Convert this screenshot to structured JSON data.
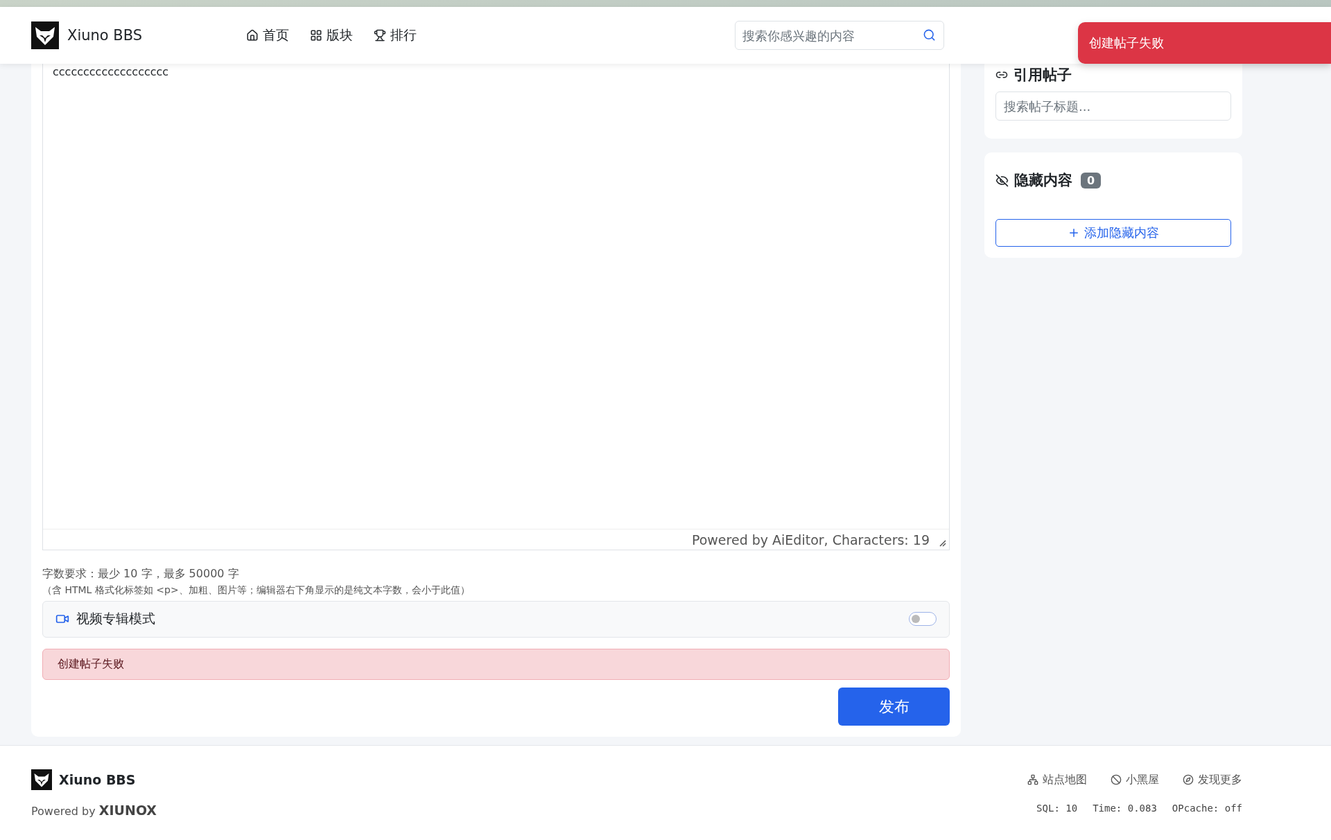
{
  "header": {
    "logo_text": "Xiuno BBS",
    "nav": [
      {
        "label": "首页"
      },
      {
        "label": "版块"
      },
      {
        "label": "排行"
      }
    ],
    "search": {
      "placeholder": "搜索你感兴趣的内容"
    }
  },
  "toast": {
    "message": "创建帖子失败"
  },
  "editor": {
    "content": "ccccccccccccccccccc",
    "status": "Powered by AiEditor, Characters: 19"
  },
  "notes": [
    "字数要求：最少 10 字，最多 50000 字",
    "（含 HTML 格式化标签如 <p>、加粗、图片等；编辑器右下角显示的是纯文本字数，会小于此值）"
  ],
  "video_mode": {
    "label": "视频专辑模式",
    "on": false
  },
  "alert": {
    "message": "创建帖子失败"
  },
  "publish_button": "发布",
  "sidebar": {
    "quote": {
      "title": "引用帖子",
      "search_placeholder": "搜索帖子标题..."
    },
    "hidden": {
      "title": "隐藏内容",
      "count": "0",
      "add_button": "添加隐藏内容"
    }
  },
  "footer": {
    "logo_text": "Xiuno BBS",
    "powered": "Powered by **XIUNOX**",
    "links": [
      {
        "label": "站点地图"
      },
      {
        "label": "小黑屋"
      },
      {
        "label": "发现更多"
      }
    ],
    "stats": [
      "SQL: 10",
      "Time: 0.083",
      "OPcache: off"
    ]
  }
}
